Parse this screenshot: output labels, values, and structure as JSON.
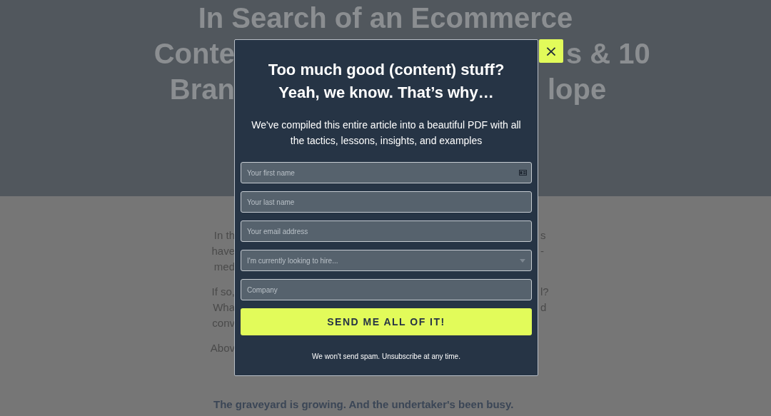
{
  "hero": {
    "title_lines": [
      {
        "left": "In Search of an Ecommerce"
      },
      {
        "left": "Conte",
        "right": "s & 10"
      },
      {
        "left": "Bran",
        "right": "lope"
      }
    ]
  },
  "article": {
    "lines": [
      {
        "left": "In th",
        "right": "s"
      },
      {
        "left": "have",
        "right": "-"
      },
      {
        "left": "med"
      },
      {
        "left": "If so,",
        "right": "l?"
      },
      {
        "left": "Wha",
        "right": "d"
      },
      {
        "left": "conv"
      },
      {
        "left": "Abov"
      }
    ],
    "subheading": "The graveyard is growing. And the undertaker's been busy."
  },
  "modal": {
    "close": "×",
    "title": "Too much good (content) stuff? Yeah, we know. That’s why…",
    "subtitle": "We've compiled this entire article into a beautiful PDF with all the tactics, lessons, insights, and examples",
    "fields": [
      {
        "kind": "text",
        "placeholder": "Your first name",
        "autofill_icon": true
      },
      {
        "kind": "text",
        "placeholder": "Your last name"
      },
      {
        "kind": "text",
        "placeholder": "Your email address"
      },
      {
        "kind": "select",
        "placeholder": "I'm currently looking to hire..."
      },
      {
        "kind": "text",
        "placeholder": "Company"
      }
    ],
    "submit": "SEND ME ALL OF IT!",
    "note": "We won't send spam. Unsubscribe at any time."
  }
}
